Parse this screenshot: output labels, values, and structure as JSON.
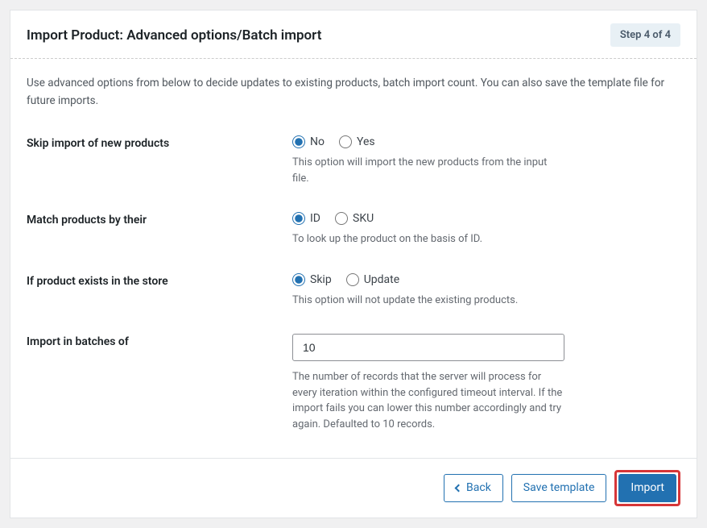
{
  "header": {
    "title": "Import Product: Advanced options/Batch import",
    "step_label": "Step 4 of 4"
  },
  "intro": "Use advanced options from below to decide updates to existing products, batch import count. You can also save the template file for future imports.",
  "fields": {
    "skip_new": {
      "label": "Skip import of new products",
      "opt_no": "No",
      "opt_yes": "Yes",
      "help": "This option will import the new products from the input file."
    },
    "match_by": {
      "label": "Match products by their",
      "opt_id": "ID",
      "opt_sku": "SKU",
      "help": "To look up the product on the basis of ID."
    },
    "if_exists": {
      "label": "If product exists in the store",
      "opt_skip": "Skip",
      "opt_update": "Update",
      "help": "This option will not update the existing products."
    },
    "batch": {
      "label": "Import in batches of",
      "value": "10",
      "help": "The number of records that the server will process for every iteration within the configured timeout interval. If the import fails you can lower this number accordingly and try again. Defaulted to 10 records."
    }
  },
  "footer": {
    "back": "Back",
    "save_template": "Save template",
    "import": "Import"
  }
}
